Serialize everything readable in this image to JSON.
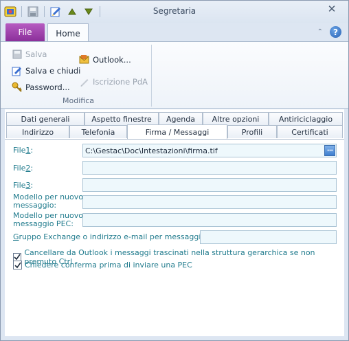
{
  "window": {
    "title": "Segretaria",
    "close_symbol": "✕"
  },
  "qat": {
    "icons": [
      "app-icon",
      "save-icon",
      "edit-icon",
      "arrow-up-icon",
      "arrow-down-icon"
    ]
  },
  "ribbon_tabs": {
    "file": "File",
    "home": "Home"
  },
  "ribbon": {
    "group_label": "Modifica",
    "save": "Salva",
    "save_close": "Salva e chiudi",
    "password": "Password...",
    "outlook": "Outlook...",
    "iscrizione": "Iscrizione PdA",
    "help_symbol": "?",
    "collapse_symbol": "⌃"
  },
  "tabs_row1": [
    {
      "label": "Dati generali"
    },
    {
      "label": "Aspetto finestre"
    },
    {
      "label": "Agenda"
    },
    {
      "label": "Altre opzioni"
    },
    {
      "label": "Antiriciclaggio"
    }
  ],
  "tabs_row2": [
    {
      "label": "Indirizzo"
    },
    {
      "label": "Telefonia"
    },
    {
      "label": "Firma / Messaggi"
    },
    {
      "label": "Profili"
    },
    {
      "label": "Certificati"
    }
  ],
  "form": {
    "file1_label_pre": "File ",
    "file1_label_key": "1",
    "file1_label_post": ":",
    "file1_value": "C:\\Gestac\\Doc\\Intestazioni\\firma.tif",
    "file2_label_pre": "File ",
    "file2_label_key": "2",
    "file2_label_post": ":",
    "file2_value": "",
    "file3_label_pre": "File ",
    "file3_label_key": "3",
    "file3_label_post": ":",
    "file3_value": "",
    "modello_line1": "Modello per nuovo",
    "modello_line2": "messaggio:",
    "modello_value": "",
    "modello_pec_line1": "Modello per nuovo",
    "modello_pec_line2": "messaggio PEC:",
    "modello_pec_value": "",
    "gruppo_key": "G",
    "gruppo_label": "ruppo Exchange o indirizzo e-mail per messaggi inviati:",
    "gruppo_value": "",
    "browse_symbol": "···"
  },
  "checkboxes": [
    {
      "label": "Cancellare da Outlook i messaggi trascinati nella struttura gerarchica se non premuto Ctrl",
      "checked": true
    },
    {
      "label": "Chiedere conferma prima di inviare una PEC",
      "checked": true
    }
  ],
  "colors": {
    "file_tab": "#8b2f9a",
    "field_bg": "#eef8fc",
    "label_teal": "#1f7a8c"
  }
}
